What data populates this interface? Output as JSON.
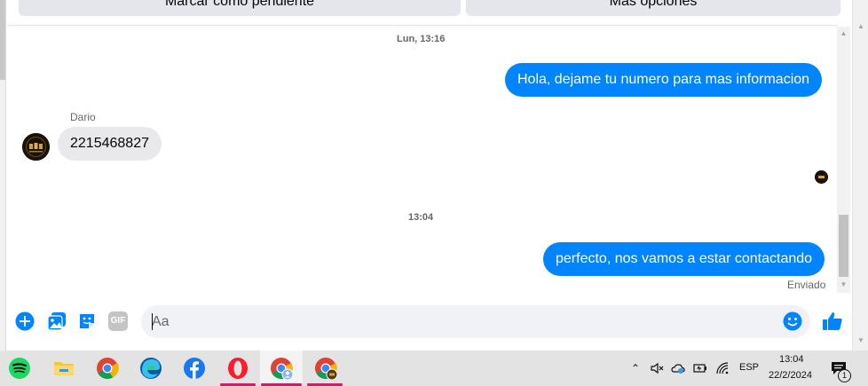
{
  "header": {
    "mark_pending_label": "Marcar como pendiente",
    "more_options_label": "Más opciones"
  },
  "chat": {
    "messages": [
      {
        "type": "timestamp",
        "text": "Lun, 13:16"
      },
      {
        "type": "outgoing",
        "text": "Hola, dejame tu numero para mas informacion"
      },
      {
        "type": "incoming",
        "sender": "Dario",
        "text": "2215468827"
      },
      {
        "type": "timestamp",
        "text": "13:04"
      },
      {
        "type": "outgoing",
        "text": "perfecto, nos vamos a estar contactando"
      }
    ],
    "status": "Enviado"
  },
  "composer": {
    "placeholder": "Aa",
    "icons": [
      "add-icon",
      "image-icon",
      "sticker-icon",
      "gif-icon",
      "emoji-icon",
      "like-icon"
    ],
    "gif_label": "GIF"
  },
  "taskbar": {
    "apps": [
      "spotify-icon",
      "file-explorer-icon",
      "chrome-icon",
      "edge-icon",
      "facebook-icon",
      "opera-icon",
      "chrome-profile-icon",
      "chrome-profile-2-icon"
    ],
    "tray": {
      "language": "ESP",
      "time": "13:04",
      "date": "22/2/2024",
      "notifications": "1"
    }
  },
  "colors": {
    "accent": "#0084ff",
    "incoming_bubble": "#e9e9eb",
    "taskbar": "#e3e3e3",
    "active_indicator": "#c61f6b"
  }
}
